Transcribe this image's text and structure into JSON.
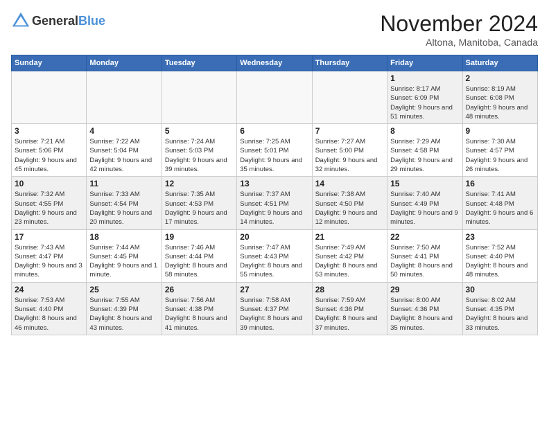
{
  "header": {
    "logo_general": "General",
    "logo_blue": "Blue",
    "month": "November 2024",
    "location": "Altona, Manitoba, Canada"
  },
  "days_of_week": [
    "Sunday",
    "Monday",
    "Tuesday",
    "Wednesday",
    "Thursday",
    "Friday",
    "Saturday"
  ],
  "weeks": [
    [
      {
        "day": "",
        "detail": ""
      },
      {
        "day": "",
        "detail": ""
      },
      {
        "day": "",
        "detail": ""
      },
      {
        "day": "",
        "detail": ""
      },
      {
        "day": "",
        "detail": ""
      },
      {
        "day": "1",
        "detail": "Sunrise: 8:17 AM\nSunset: 6:09 PM\nDaylight: 9 hours and 51 minutes."
      },
      {
        "day": "2",
        "detail": "Sunrise: 8:19 AM\nSunset: 6:08 PM\nDaylight: 9 hours and 48 minutes."
      }
    ],
    [
      {
        "day": "3",
        "detail": "Sunrise: 7:21 AM\nSunset: 5:06 PM\nDaylight: 9 hours and 45 minutes."
      },
      {
        "day": "4",
        "detail": "Sunrise: 7:22 AM\nSunset: 5:04 PM\nDaylight: 9 hours and 42 minutes."
      },
      {
        "day": "5",
        "detail": "Sunrise: 7:24 AM\nSunset: 5:03 PM\nDaylight: 9 hours and 39 minutes."
      },
      {
        "day": "6",
        "detail": "Sunrise: 7:25 AM\nSunset: 5:01 PM\nDaylight: 9 hours and 35 minutes."
      },
      {
        "day": "7",
        "detail": "Sunrise: 7:27 AM\nSunset: 5:00 PM\nDaylight: 9 hours and 32 minutes."
      },
      {
        "day": "8",
        "detail": "Sunrise: 7:29 AM\nSunset: 4:58 PM\nDaylight: 9 hours and 29 minutes."
      },
      {
        "day": "9",
        "detail": "Sunrise: 7:30 AM\nSunset: 4:57 PM\nDaylight: 9 hours and 26 minutes."
      }
    ],
    [
      {
        "day": "10",
        "detail": "Sunrise: 7:32 AM\nSunset: 4:55 PM\nDaylight: 9 hours and 23 minutes."
      },
      {
        "day": "11",
        "detail": "Sunrise: 7:33 AM\nSunset: 4:54 PM\nDaylight: 9 hours and 20 minutes."
      },
      {
        "day": "12",
        "detail": "Sunrise: 7:35 AM\nSunset: 4:53 PM\nDaylight: 9 hours and 17 minutes."
      },
      {
        "day": "13",
        "detail": "Sunrise: 7:37 AM\nSunset: 4:51 PM\nDaylight: 9 hours and 14 minutes."
      },
      {
        "day": "14",
        "detail": "Sunrise: 7:38 AM\nSunset: 4:50 PM\nDaylight: 9 hours and 12 minutes."
      },
      {
        "day": "15",
        "detail": "Sunrise: 7:40 AM\nSunset: 4:49 PM\nDaylight: 9 hours and 9 minutes."
      },
      {
        "day": "16",
        "detail": "Sunrise: 7:41 AM\nSunset: 4:48 PM\nDaylight: 9 hours and 6 minutes."
      }
    ],
    [
      {
        "day": "17",
        "detail": "Sunrise: 7:43 AM\nSunset: 4:47 PM\nDaylight: 9 hours and 3 minutes."
      },
      {
        "day": "18",
        "detail": "Sunrise: 7:44 AM\nSunset: 4:45 PM\nDaylight: 9 hours and 1 minute."
      },
      {
        "day": "19",
        "detail": "Sunrise: 7:46 AM\nSunset: 4:44 PM\nDaylight: 8 hours and 58 minutes."
      },
      {
        "day": "20",
        "detail": "Sunrise: 7:47 AM\nSunset: 4:43 PM\nDaylight: 8 hours and 55 minutes."
      },
      {
        "day": "21",
        "detail": "Sunrise: 7:49 AM\nSunset: 4:42 PM\nDaylight: 8 hours and 53 minutes."
      },
      {
        "day": "22",
        "detail": "Sunrise: 7:50 AM\nSunset: 4:41 PM\nDaylight: 8 hours and 50 minutes."
      },
      {
        "day": "23",
        "detail": "Sunrise: 7:52 AM\nSunset: 4:40 PM\nDaylight: 8 hours and 48 minutes."
      }
    ],
    [
      {
        "day": "24",
        "detail": "Sunrise: 7:53 AM\nSunset: 4:40 PM\nDaylight: 8 hours and 46 minutes."
      },
      {
        "day": "25",
        "detail": "Sunrise: 7:55 AM\nSunset: 4:39 PM\nDaylight: 8 hours and 43 minutes."
      },
      {
        "day": "26",
        "detail": "Sunrise: 7:56 AM\nSunset: 4:38 PM\nDaylight: 8 hours and 41 minutes."
      },
      {
        "day": "27",
        "detail": "Sunrise: 7:58 AM\nSunset: 4:37 PM\nDaylight: 8 hours and 39 minutes."
      },
      {
        "day": "28",
        "detail": "Sunrise: 7:59 AM\nSunset: 4:36 PM\nDaylight: 8 hours and 37 minutes."
      },
      {
        "day": "29",
        "detail": "Sunrise: 8:00 AM\nSunset: 4:36 PM\nDaylight: 8 hours and 35 minutes."
      },
      {
        "day": "30",
        "detail": "Sunrise: 8:02 AM\nSunset: 4:35 PM\nDaylight: 8 hours and 33 minutes."
      }
    ]
  ]
}
